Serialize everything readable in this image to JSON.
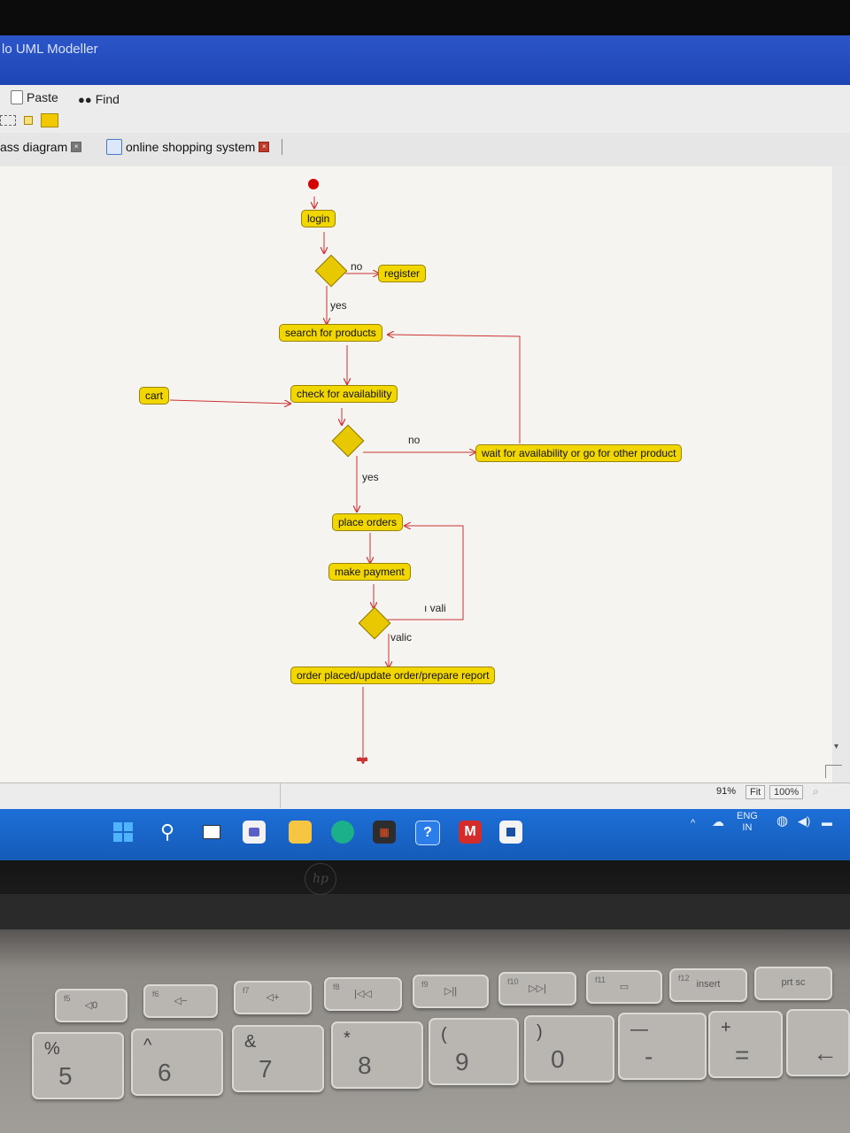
{
  "window": {
    "title": "lo UML Modeller"
  },
  "toolbar": {
    "paste_label": "Paste",
    "find_label": "Find"
  },
  "tabs": [
    {
      "label": "ass diagram"
    },
    {
      "label": "online shopping system"
    }
  ],
  "diagram": {
    "nodes": {
      "login": "login",
      "register": "register",
      "search": "search for products",
      "cart": "cart",
      "check": "check for availability",
      "wait": "wait for availability or go for other product",
      "place": "place orders",
      "payment": "make payment",
      "report": "order placed/update order/prepare report"
    },
    "guards": {
      "no1": "no",
      "yes1": "yes",
      "no2": "no",
      "yes2": "yes",
      "invalid": "ı vali",
      "valid": "valic"
    }
  },
  "statusbar": {
    "zoom_percent": "91%",
    "fit_label": "Fit",
    "zoom_100": "100%"
  },
  "taskbar": {
    "lang_top": "ENG",
    "lang_bottom": "IN"
  },
  "keyboard": {
    "fkeys": [
      {
        "sub": "f5",
        "label": "◁0"
      },
      {
        "sub": "f6",
        "label": "◁−"
      },
      {
        "sub": "f7",
        "label": "◁+"
      },
      {
        "sub": "f8",
        "label": "|◁◁"
      },
      {
        "sub": "f9",
        "label": "▷||"
      },
      {
        "sub": "f10",
        "label": "▷▷|"
      },
      {
        "sub": "f11",
        "label": "▭"
      },
      {
        "sub": "f12",
        "label": "insert"
      },
      {
        "sub": "",
        "label": "prt sc"
      }
    ],
    "numkeys": [
      {
        "top": "%",
        "bottom": "5"
      },
      {
        "top": "^",
        "bottom": "6"
      },
      {
        "top": "&",
        "bottom": "7"
      },
      {
        "top": "*",
        "bottom": "8"
      },
      {
        "top": "(",
        "bottom": "9"
      },
      {
        "top": ")",
        "bottom": "0"
      },
      {
        "top": "—",
        "bottom": "-"
      },
      {
        "top": "+",
        "bottom": "="
      },
      {
        "top": "",
        "bottom": "←"
      }
    ]
  },
  "colors": {
    "node_fill": "#f2d600",
    "connector": "#cc3333",
    "taskbar": "#1d6fd8",
    "titlebar": "#2c56c9"
  }
}
